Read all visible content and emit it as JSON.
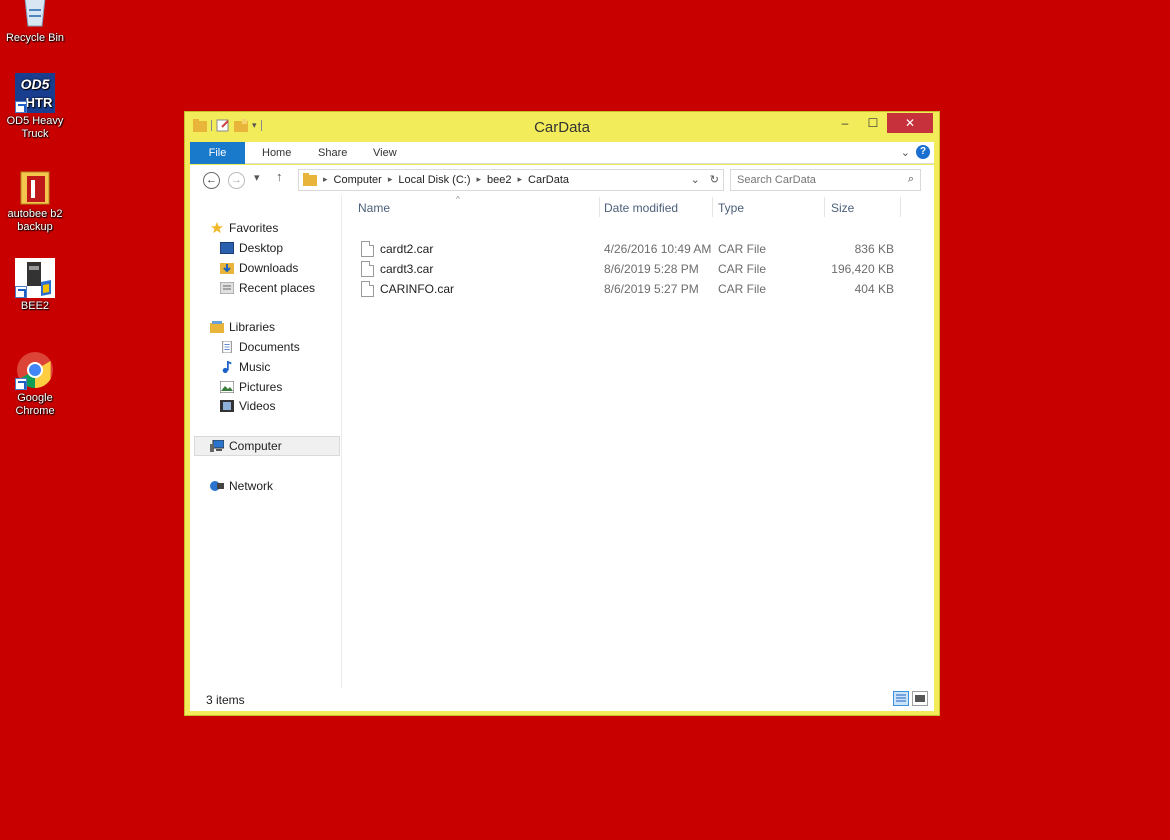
{
  "desktop": {
    "icons": [
      {
        "label": "Recycle Bin"
      },
      {
        "label": "OD5 Heavy Truck",
        "badge_top": "OD5",
        "badge_bottom": "HTR"
      },
      {
        "label": "autobee b2 backup"
      },
      {
        "label": "BEE2"
      },
      {
        "label": "Google Chrome"
      }
    ]
  },
  "window": {
    "title": "CarData",
    "controls": {
      "minimize": "–",
      "maximize": "☐",
      "close": "✕"
    }
  },
  "ribbon": {
    "tabs": [
      "File",
      "Home",
      "Share",
      "View"
    ],
    "expand": "⌄",
    "help": "?"
  },
  "navigation": {
    "back": "←",
    "forward": "→",
    "recent": "▾",
    "up": "↑",
    "breadcrumb": [
      "Computer",
      "Local Disk (C:)",
      "bee2",
      "CarData"
    ],
    "address_dropdown": "⌄",
    "refresh": "↻",
    "search_placeholder": "Search CarData",
    "search_icon": "⌕"
  },
  "nav_pane": {
    "favorites": {
      "label": "Favorites",
      "items": [
        "Desktop",
        "Downloads",
        "Recent places"
      ]
    },
    "libraries": {
      "label": "Libraries",
      "items": [
        "Documents",
        "Music",
        "Pictures",
        "Videos"
      ]
    },
    "computer": "Computer",
    "network": "Network"
  },
  "file_list": {
    "columns": [
      "Name",
      "Date modified",
      "Type",
      "Size"
    ],
    "rows": [
      {
        "name": "cardt2.car",
        "date": "4/26/2016 10:49 AM",
        "type": "CAR File",
        "size": "836 KB"
      },
      {
        "name": "cardt3.car",
        "date": "8/6/2019 5:28 PM",
        "type": "CAR File",
        "size": "196,420 KB"
      },
      {
        "name": "CARINFO.car",
        "date": "8/6/2019 5:27 PM",
        "type": "CAR File",
        "size": "404 KB"
      }
    ]
  },
  "status": {
    "item_count": "3 items"
  },
  "colors": {
    "desktop": "#c90000",
    "window_frame": "#f3ec5a",
    "file_tab": "#1979ca",
    "close": "#c7313b"
  }
}
